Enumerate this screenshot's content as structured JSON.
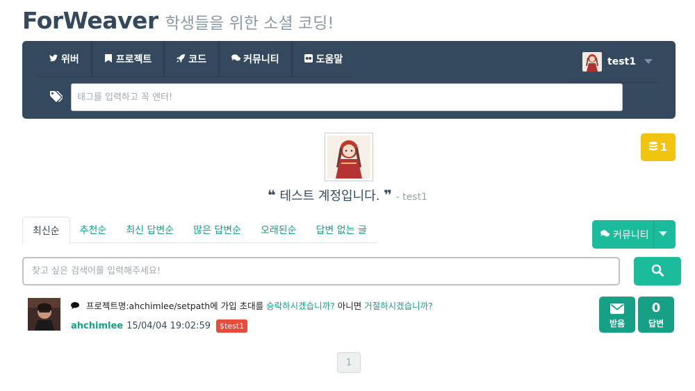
{
  "header": {
    "brand": "ForWeaver",
    "tagline": "학생들을 위한 소셜 코딩!"
  },
  "nav": {
    "items": [
      {
        "label": "위버",
        "icon": "twitter-icon"
      },
      {
        "label": "프로젝트",
        "icon": "bookmark-icon"
      },
      {
        "label": "코드",
        "icon": "rocket-icon"
      },
      {
        "label": "커뮤니티",
        "icon": "comments-icon"
      },
      {
        "label": "도움말",
        "icon": "flickr-icon"
      }
    ],
    "user": "test1",
    "tag_placeholder": "태그를 입력하고 꼭 엔터!"
  },
  "profile": {
    "coins": "1",
    "quote": "테스트 계정입니다.",
    "author": "- test1"
  },
  "tabs": [
    "최신순",
    "추천순",
    "최신 답변순",
    "많은 답변순",
    "오래된순",
    "답변 없는 글"
  ],
  "community_button": "커뮤니티",
  "search": {
    "placeholder": "찾고 싶은 검색어를 입력해주세요!"
  },
  "post": {
    "prefix": "프로젝트명:ahchimlee/setpath에 가입 초대를 ",
    "accept_link": "승락하시겠습니까?",
    "middle": " 아니면 ",
    "reject_link": "거절하시겠습니까?",
    "author": "ahchimlee",
    "date": "15/04/04 19:02:59",
    "tag": "$test1",
    "inbox_label": "받음",
    "answer_count": "0",
    "answer_label": "답변"
  },
  "pagination": {
    "current": "1"
  },
  "colors": {
    "navbar": "#34495e",
    "accent": "#1abc9c",
    "coin": "#f1c40f",
    "tag": "#e74c3c"
  }
}
